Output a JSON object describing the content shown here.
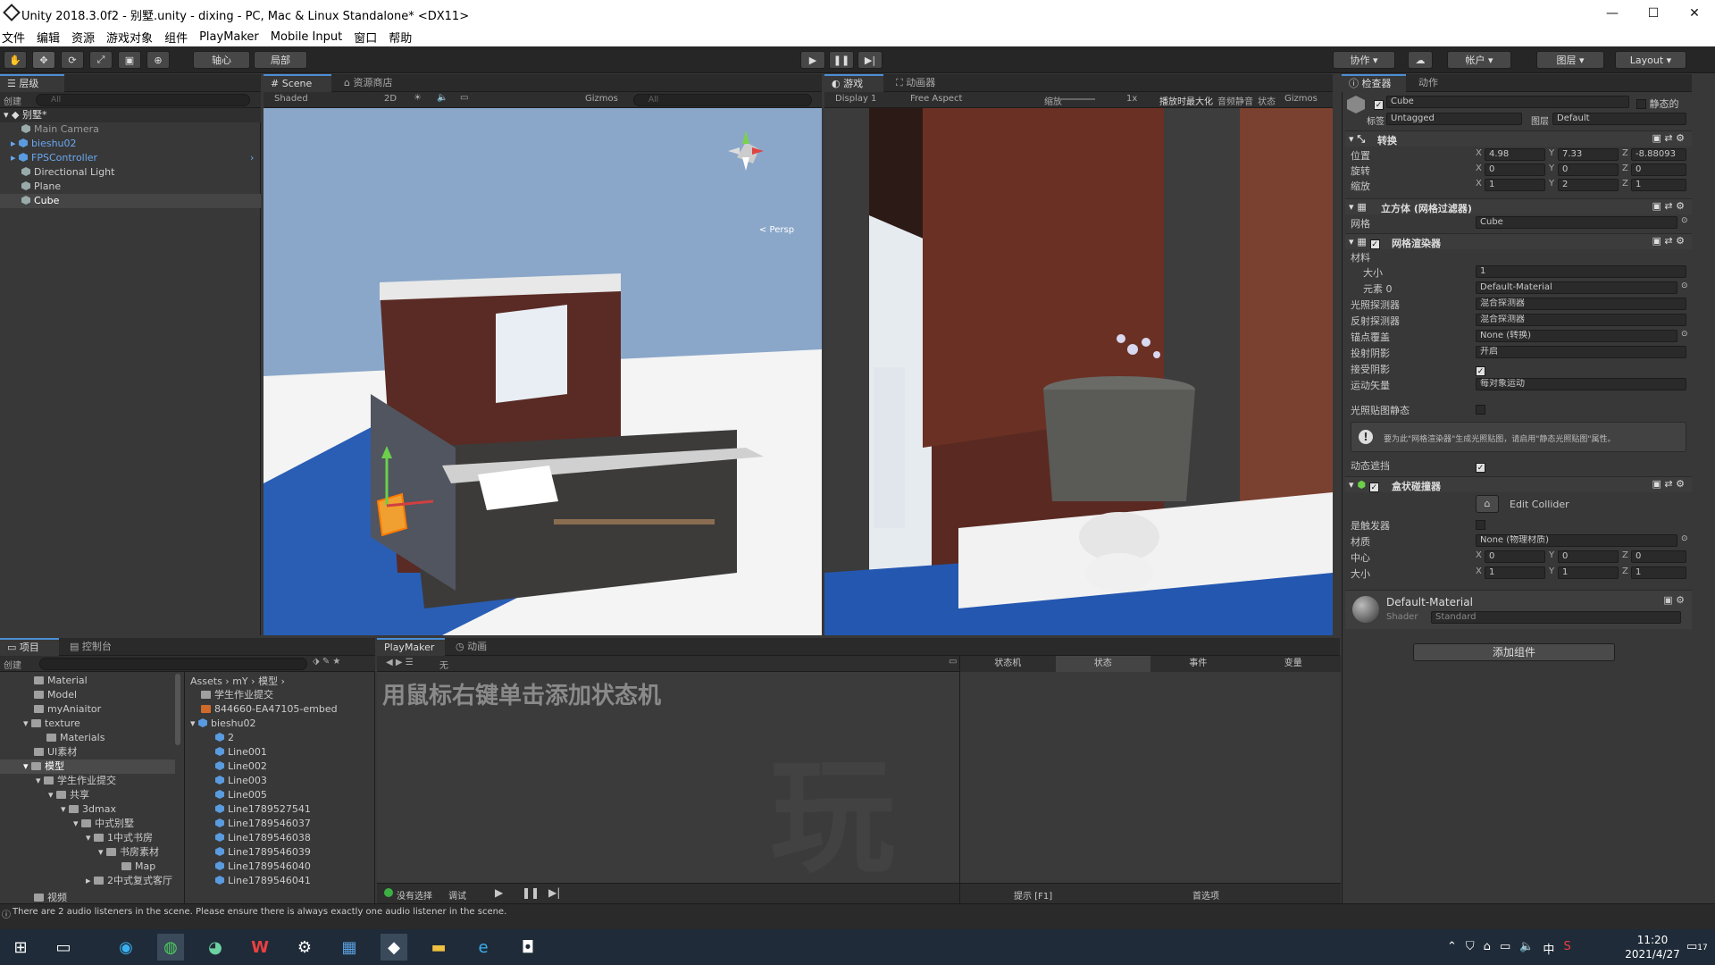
{
  "window": {
    "title": "Unity 2018.3.0f2 - 别墅.unity - dixing - PC, Mac & Linux Standalone* <DX11>",
    "min": "—",
    "max": "☐",
    "close": "✕"
  },
  "menu": [
    "文件",
    "编辑",
    "资源",
    "游戏对象",
    "组件",
    "PlayMaker",
    "Mobile Input",
    "窗口",
    "帮助"
  ],
  "toolbar": {
    "pivot": "轴心",
    "local": "局部",
    "collab": "协作",
    "account": "帐户",
    "layers": "图层",
    "layout": "Layout"
  },
  "hierarchy": {
    "tab": "层级",
    "create": "创建",
    "search": "All",
    "scene": "别墅*",
    "items": [
      {
        "label": "Main Camera",
        "grey": true
      },
      {
        "label": "bieshu02",
        "blue": true
      },
      {
        "label": "FPSController",
        "blue": true
      },
      {
        "label": "Directional Light"
      },
      {
        "label": "Plane"
      },
      {
        "label": "Cube",
        "selected": true
      }
    ]
  },
  "scene": {
    "tab": "Scene",
    "tab2": "资源商店",
    "shading": "Shaded",
    "mode2d": "2D",
    "gizmos": "Gizmos",
    "search": "All",
    "persp": "< Persp"
  },
  "game": {
    "tab": "游戏",
    "tab2": "动画器",
    "display": "Display 1",
    "aspect": "Free Aspect",
    "scale_label": "缩放",
    "scale": "1x",
    "maximize": "播放时最大化",
    "mute": "音频静音",
    "stats": "状态",
    "gizmos": "Gizmos"
  },
  "inspector": {
    "tab": "检查器",
    "tab2": "动作",
    "object_name": "Cube",
    "static_label": "静态的",
    "tag_label": "标签",
    "tag": "Untagged",
    "layer_label": "图层",
    "layer": "Default",
    "transform": {
      "title": "转换",
      "position": {
        "label": "位置",
        "x": "4.98",
        "y": "7.33",
        "z": "-8.88093"
      },
      "rotation": {
        "label": "旋转",
        "x": "0",
        "y": "0",
        "z": "0"
      },
      "scale": {
        "label": "缩放",
        "x": "1",
        "y": "2",
        "z": "1"
      }
    },
    "meshfilter": {
      "title": "立方体 (网格过滤器)",
      "mesh_label": "网格",
      "mesh": "Cube"
    },
    "meshrenderer": {
      "title": "网格渲染器",
      "materials": "材料",
      "size_label": "大小",
      "size": "1",
      "element_label": "元素 0",
      "element": "Default-Material",
      "lightprobe_label": "光照探测器",
      "lightprobe": "混合探测器",
      "reflprobe_label": "反射探测器",
      "reflprobe": "混合探测器",
      "anchor_label": "锚点覆盖",
      "anchor": "None (转换)",
      "cast_label": "投射阴影",
      "cast": "开启",
      "receive_label": "接受阴影",
      "motion_label": "运动矢量",
      "motion": "每对象运动",
      "lightmap_static": "光照贴图静态",
      "info": "要为此\"网格渲染器\"生成光照贴图，请启用\"静态光照贴图\"属性。",
      "dynamic_occl": "动态遮挡"
    },
    "boxcollider": {
      "title": "盒状碰撞器",
      "edit": "Edit Collider",
      "trigger_label": "是触发器",
      "material_label": "材质",
      "material": "None (物理材质)",
      "center": {
        "label": "中心",
        "x": "0",
        "y": "0",
        "z": "0"
      },
      "size": {
        "label": "大小",
        "x": "1",
        "y": "1",
        "z": "1"
      }
    },
    "material": {
      "name": "Default-Material",
      "shader_label": "Shader",
      "shader": "Standard"
    },
    "add_component": "添加组件"
  },
  "project": {
    "tab": "项目",
    "tab2": "控制台",
    "create": "创建",
    "tree": [
      {
        "label": "Material",
        "d": 1
      },
      {
        "label": "Model",
        "d": 1
      },
      {
        "label": "myAniaitor",
        "d": 1
      },
      {
        "label": "texture",
        "d": 1,
        "open": true
      },
      {
        "label": "Materials",
        "d": 2
      },
      {
        "label": "UI素材",
        "d": 1
      },
      {
        "label": "模型",
        "d": 1,
        "open": true,
        "sel": true
      },
      {
        "label": "学生作业提交",
        "d": 2,
        "open": true
      },
      {
        "label": "共享",
        "d": 3,
        "open": true
      },
      {
        "label": "3dmax",
        "d": 4,
        "open": true
      },
      {
        "label": "中式别墅",
        "d": 5,
        "open": true
      },
      {
        "label": "1中式书房",
        "d": 6,
        "open": true
      },
      {
        "label": "书房素材",
        "d": 7,
        "open": true
      },
      {
        "label": "Map",
        "d": 8
      },
      {
        "label": "2中式复式客厅",
        "d": 6
      },
      {
        "label": "视频",
        "d": 1
      }
    ],
    "crumbs": [
      "Assets",
      "mY",
      "模型"
    ],
    "assets": [
      {
        "label": "学生作业提交",
        "t": "folder",
        "d": 0
      },
      {
        "label": "844660-EA47105-embed",
        "t": "img",
        "d": 0
      },
      {
        "label": "bieshu02",
        "t": "mesh",
        "d": 0,
        "open": true
      },
      {
        "label": "2",
        "t": "mesh",
        "d": 1
      },
      {
        "label": "Line001",
        "t": "mesh",
        "d": 1
      },
      {
        "label": "Line002",
        "t": "mesh",
        "d": 1
      },
      {
        "label": "Line003",
        "t": "mesh",
        "d": 1
      },
      {
        "label": "Line005",
        "t": "mesh",
        "d": 1
      },
      {
        "label": "Line1789527541",
        "t": "mesh",
        "d": 1
      },
      {
        "label": "Line1789546037",
        "t": "mesh",
        "d": 1
      },
      {
        "label": "Line1789546038",
        "t": "mesh",
        "d": 1
      },
      {
        "label": "Line1789546039",
        "t": "mesh",
        "d": 1
      },
      {
        "label": "Line1789546040",
        "t": "mesh",
        "d": 1
      },
      {
        "label": "Line1789546041",
        "t": "mesh",
        "d": 1
      }
    ]
  },
  "playmaker": {
    "tab": "PlayMaker",
    "tab2": "动画",
    "none": "无",
    "hint": "用鼠标右键单击添加状态机",
    "watermark": "玩",
    "tabs": [
      "状态机",
      "状态",
      "事件",
      "变量"
    ],
    "no_selection": "没有选择",
    "debug": "调试",
    "hints": "提示 [F1]",
    "prefs": "首选项"
  },
  "status": {
    "message": "There are 2 audio listeners in the scene. Please ensure there is always exactly one audio listener in the scene."
  },
  "taskbar": {
    "time": "11:20",
    "date": "2021/4/27",
    "ime": "中",
    "badge": "17"
  }
}
